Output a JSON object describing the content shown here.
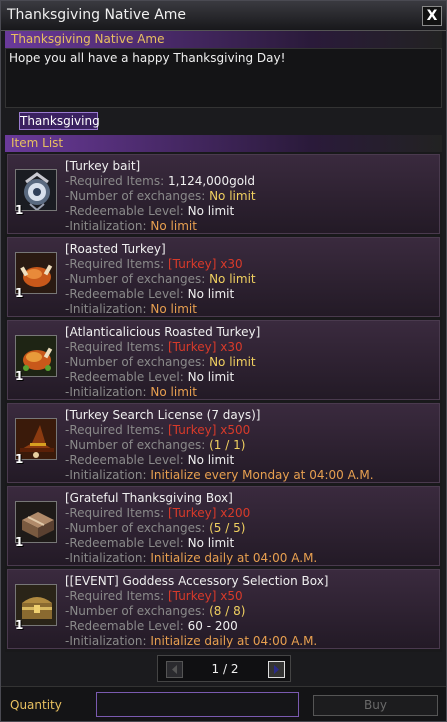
{
  "window": {
    "title": "Thanksgiving Native Ame",
    "close_label": "X"
  },
  "npc": {
    "name": "Thanksgiving Native Ame",
    "message": "Hope you all have a happy Thanksgiving Day!"
  },
  "tabs": [
    {
      "label": "Thanksgiving"
    }
  ],
  "item_list": {
    "header": "Item List",
    "labels": {
      "required": "-Required Items:",
      "exchanges": "-Number of exchanges:",
      "level": "-Redeemable Level:",
      "init": "-Initialization:"
    },
    "items": [
      {
        "name": "[Turkey bait]",
        "count": "1",
        "required": "1,124,000gold",
        "exchanges": "No limit",
        "level": "No limit",
        "init": "No limit",
        "icon": "orb-icon"
      },
      {
        "name": "[Roasted Turkey]",
        "count": "1",
        "required": "[Turkey] x30",
        "exchanges": "No limit",
        "level": "No limit",
        "init": "No limit",
        "icon": "roast-turkey-icon"
      },
      {
        "name": "[Atlanticalicious Roasted Turkey]",
        "count": "1",
        "required": "[Turkey] x30",
        "exchanges": "No limit",
        "level": "No limit",
        "init": "No limit",
        "icon": "roast-turkey-icon"
      },
      {
        "name": "[Turkey Search License (7 days)]",
        "count": "1",
        "required": "[Turkey] x500",
        "exchanges": "(1 / 1)",
        "level": "No limit",
        "init": "Initialize every Monday at 04:00 A.M.",
        "icon": "witch-hat-icon"
      },
      {
        "name": "[Grateful Thanksgiving Box]",
        "count": "1",
        "required": "[Turkey] x200",
        "exchanges": "(5 / 5)",
        "level": "No limit",
        "init": "Initialize daily at 04:00 A.M.",
        "icon": "box-icon"
      },
      {
        "name": "[[EVENT] Goddess Accessory Selection Box]",
        "count": "1",
        "required": "[Turkey] x50",
        "exchanges": "(8 / 8)",
        "level": "60 - 200",
        "init": "Initialize daily at 04:00 A.M.",
        "icon": "treasure-chest-icon"
      }
    ]
  },
  "pagination": {
    "text": "1 / 2"
  },
  "footer": {
    "quantity_label": "Quantity",
    "quantity_value": "",
    "buy_label": "Buy"
  },
  "colors": {
    "accent_purple": "#6a3a9a",
    "label_gold": "#e8c060",
    "required_red": "#d83a2a",
    "value_yellow": "#f0d060",
    "init_orange": "#e8a050"
  }
}
